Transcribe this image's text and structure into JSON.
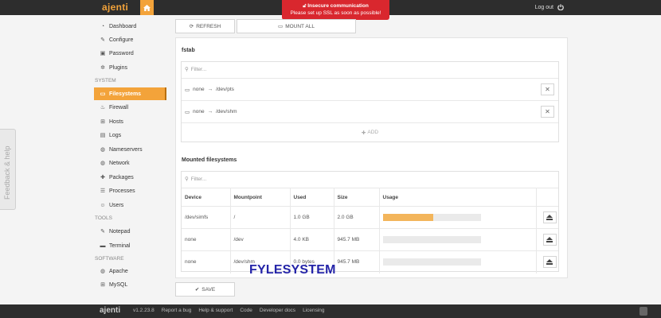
{
  "header": {
    "brand": "ajenti",
    "logout_label": "Log out",
    "alert_title": "Insecure communication",
    "alert_message": "Please set up SSL as soon as possible!"
  },
  "sidebar": {
    "items": [
      {
        "label": "Dashboard",
        "icon": "dashboard-icon",
        "glyph": "◔"
      },
      {
        "label": "Configure",
        "icon": "wrench-icon",
        "glyph": "✎"
      },
      {
        "label": "Password",
        "icon": "lock-icon",
        "glyph": "▣"
      },
      {
        "label": "Plugins",
        "icon": "gears-icon",
        "glyph": "✲"
      }
    ],
    "section_system": "SYSTEM",
    "system_items": [
      {
        "label": "Filesystems",
        "icon": "hdd-icon",
        "glyph": "▭",
        "active": true
      },
      {
        "label": "Firewall",
        "icon": "fire-icon",
        "glyph": "♨"
      },
      {
        "label": "Hosts",
        "icon": "sitemap-icon",
        "glyph": "⊞"
      },
      {
        "label": "Logs",
        "icon": "file-icon",
        "glyph": "▤"
      },
      {
        "label": "Nameservers",
        "icon": "globe-icon",
        "glyph": "◍"
      },
      {
        "label": "Network",
        "icon": "globe-icon",
        "glyph": "◍"
      },
      {
        "label": "Packages",
        "icon": "gift-icon",
        "glyph": "✚"
      },
      {
        "label": "Processes",
        "icon": "list-icon",
        "glyph": "☰"
      },
      {
        "label": "Users",
        "icon": "users-icon",
        "glyph": "☺"
      }
    ],
    "section_tools": "TOOLS",
    "tools_items": [
      {
        "label": "Notepad",
        "icon": "edit-icon",
        "glyph": "✎"
      },
      {
        "label": "Terminal",
        "icon": "terminal-icon",
        "glyph": "▬"
      }
    ],
    "section_software": "SOFTWARE",
    "software_items": [
      {
        "label": "Apache",
        "icon": "globe-icon",
        "glyph": "◍"
      },
      {
        "label": "MySQL",
        "icon": "table-icon",
        "glyph": "⊞"
      }
    ],
    "feedback_label": "Feedback & help"
  },
  "toolbar": {
    "refresh_label": "REFRESH",
    "mount_all_label": "MOUNT ALL"
  },
  "fstab": {
    "title": "fstab",
    "filter_placeholder": "Filter...",
    "rows": [
      {
        "source": "none",
        "arrow": "→",
        "target": "/dev/pts"
      },
      {
        "source": "none",
        "arrow": "→",
        "target": "/dev/shm"
      }
    ],
    "add_label": "ADD"
  },
  "mounted": {
    "title": "Mounted filesystems",
    "filter_placeholder": "Filter...",
    "columns": [
      "Device",
      "Mountpoint",
      "Used",
      "Size",
      "Usage"
    ],
    "rows": [
      {
        "device": "/dev/simfs",
        "mountpoint": "/",
        "used": "1.0 GB",
        "size": "2.0 GB",
        "usage": 0.52
      },
      {
        "device": "none",
        "mountpoint": "/dev",
        "used": "4.0 KB",
        "size": "945.7 MB",
        "usage": 0.0
      },
      {
        "device": "none",
        "mountpoint": "/dev/shm",
        "used": "0.0 bytes",
        "size": "945.7 MB",
        "usage": 0.0
      }
    ]
  },
  "save_label": "SAVE",
  "overlay_text": "FYLESYSTEM",
  "footer": {
    "logo": "ajenti",
    "links": [
      "v1.2.23.8",
      "Report a bug",
      "Help & support",
      "Code",
      "Developer docs",
      "Licensing"
    ]
  },
  "colors": {
    "accent": "#f3a33a",
    "alert": "#d9272e",
    "topbar": "#2d2d2d",
    "usage_fill": "#f3b55b"
  }
}
